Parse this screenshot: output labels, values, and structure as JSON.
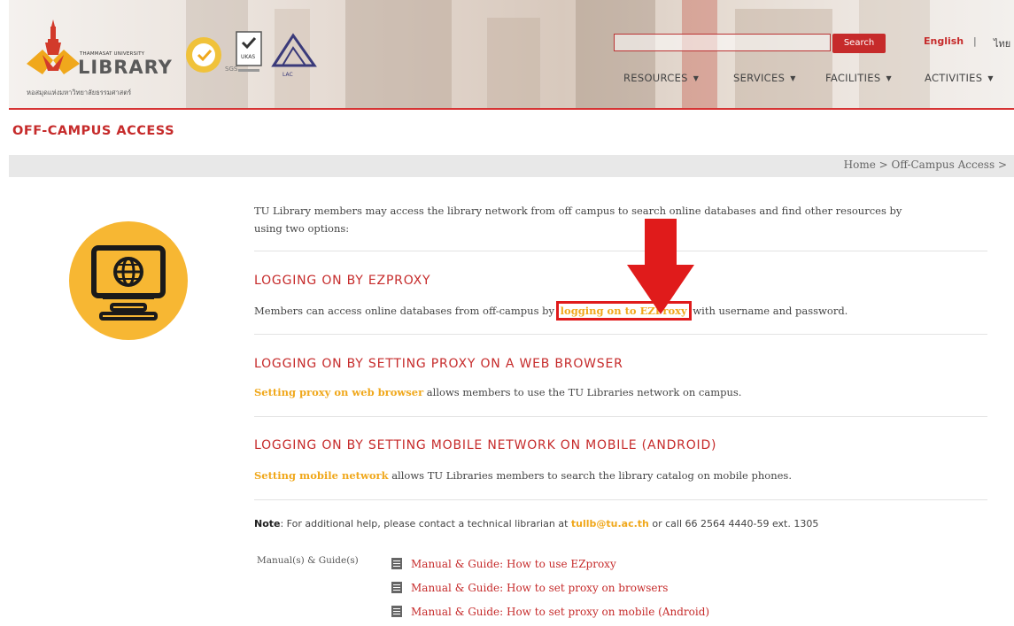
{
  "header": {
    "logo": {
      "university": "THAMMASAT UNIVERSITY",
      "library": "LIBRARY",
      "thai_name": "หอสมุดแห่งมหาวิทยาลัยธรรมศาสตร์"
    },
    "certifications": [
      "SGS",
      "UKAS",
      "LAC"
    ],
    "search": {
      "placeholder": "",
      "button": "Search"
    },
    "languages": {
      "english": "English",
      "separator": "|",
      "thai": "ไทย"
    },
    "nav": [
      {
        "label": "RESOURCES"
      },
      {
        "label": "SERVICES"
      },
      {
        "label": "FACILITIES"
      },
      {
        "label": "ACTIVITIES"
      }
    ]
  },
  "page": {
    "title": "OFF-CAMPUS ACCESS",
    "breadcrumb": "Home > Off-Campus Access >"
  },
  "content": {
    "intro_line1": "TU Library members may access the library network from off campus to search online databases and find other resources by",
    "intro_line2": "using two options:",
    "sections": [
      {
        "heading": "LOGGING ON BY EZPROXY",
        "text_before": "Members can access online databases from off-campus by ",
        "link": "logging on to EZProxy",
        "text_after": " with username and password."
      },
      {
        "heading": "LOGGING ON BY SETTING PROXY ON A WEB BROWSER",
        "link": "Setting proxy on web browser",
        "text_after": " allows members to use the TU Libraries network on campus."
      },
      {
        "heading": "LOGGING ON BY SETTING MOBILE NETWORK ON MOBILE (ANDROID)",
        "link": "Setting mobile network",
        "text_after": " allows TU Libraries members to search the library catalog on mobile phones."
      }
    ],
    "note": {
      "label": "Note",
      "text_before": ": For additional help, please contact a technical librarian at ",
      "email": "tullb@tu.ac.th",
      "text_after": " or call 66 2564 4440-59 ext. 1305"
    },
    "manuals_label": "Manual(s) & Guide(s)",
    "manuals": [
      "Manual & Guide: How to use EZproxy",
      "Manual & Guide: How to set proxy on browsers",
      "Manual & Guide: How to set proxy on mobile (Android)"
    ]
  },
  "colors": {
    "accent_red": "#c62b2b",
    "link_yellow": "#f0a81c",
    "icon_circle": "#f7b733",
    "highlight_box": "#e01b1b"
  }
}
